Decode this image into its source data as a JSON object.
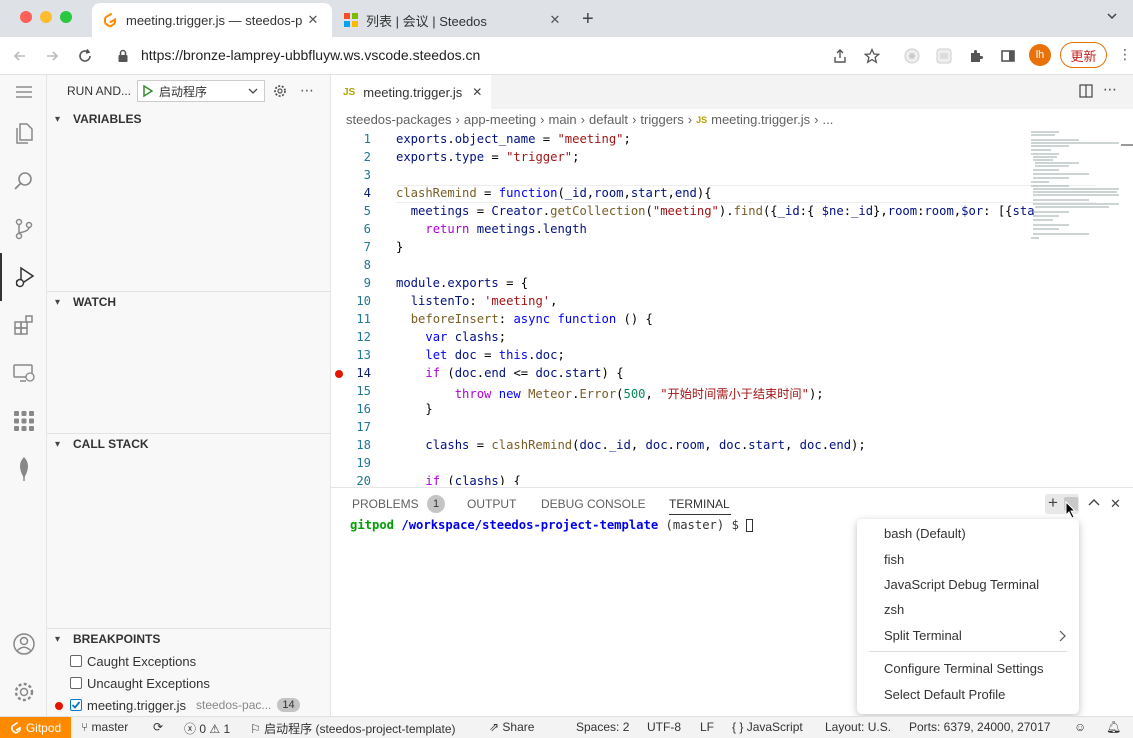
{
  "browser": {
    "tabs": [
      {
        "title": "meeting.trigger.js — steedos-p",
        "active": true
      },
      {
        "title": "列表 | 会议 | Steedos",
        "active": false
      }
    ],
    "url": "https://bronze-lamprey-ubbfluyw.ws.vscode.steedos.cn",
    "profile_initial": "lh",
    "update_label": "更新"
  },
  "debug": {
    "title": "RUN AND...",
    "config": "启动程序",
    "sections": {
      "variables": "VARIABLES",
      "watch": "WATCH",
      "call_stack": "CALL STACK",
      "breakpoints": "BREAKPOINTS"
    },
    "breakpoints": [
      {
        "label": "Caught Exceptions",
        "checked": false
      },
      {
        "label": "Uncaught Exceptions",
        "checked": false
      },
      {
        "label": "meeting.trigger.js",
        "checked": true,
        "path": "steedos-pac...",
        "line": "14"
      }
    ]
  },
  "editor": {
    "tab": "meeting.trigger.js",
    "tab_badge": "JS",
    "breadcrumbs": [
      "steedos-packages",
      "app-meeting",
      "main",
      "default",
      "triggers",
      "meeting.trigger.js",
      "..."
    ],
    "line_numbers": [
      "1",
      "2",
      "3",
      "4",
      "5",
      "6",
      "7",
      "8",
      "9",
      "10",
      "11",
      "12",
      "13",
      "14",
      "15",
      "16",
      "17",
      "18",
      "19",
      "20"
    ],
    "breakpoint_line": "14"
  },
  "panel": {
    "tabs": [
      "PROBLEMS",
      "OUTPUT",
      "DEBUG CONSOLE",
      "TERMINAL"
    ],
    "problems_count": "1",
    "prompt_user": "gitpod",
    "prompt_path": "/workspace/steedos-project-template",
    "prompt_branch": "(master) $"
  },
  "menu": {
    "items": [
      "bash (Default)",
      "fish",
      "JavaScript Debug Terminal",
      "zsh",
      "Split Terminal"
    ],
    "items2": [
      "Configure Terminal Settings",
      "Select Default Profile"
    ]
  },
  "status": {
    "gitpod": "Gitpod",
    "branch": "master",
    "errors": "0",
    "warnings": "1",
    "launch": "启动程序 (steedos-project-template)",
    "share": "Share",
    "spaces": "Spaces: 2",
    "encoding": "UTF-8",
    "eol": "LF",
    "lang_icon": "{ }",
    "language": "JavaScript",
    "layout": "Layout: U.S.",
    "ports": "Ports: 6379, 24000, 27017"
  },
  "colors": {
    "gitpod_orange": "#ff8a00",
    "breakpoint_red": "#e51400",
    "run_green": "#388a34"
  }
}
